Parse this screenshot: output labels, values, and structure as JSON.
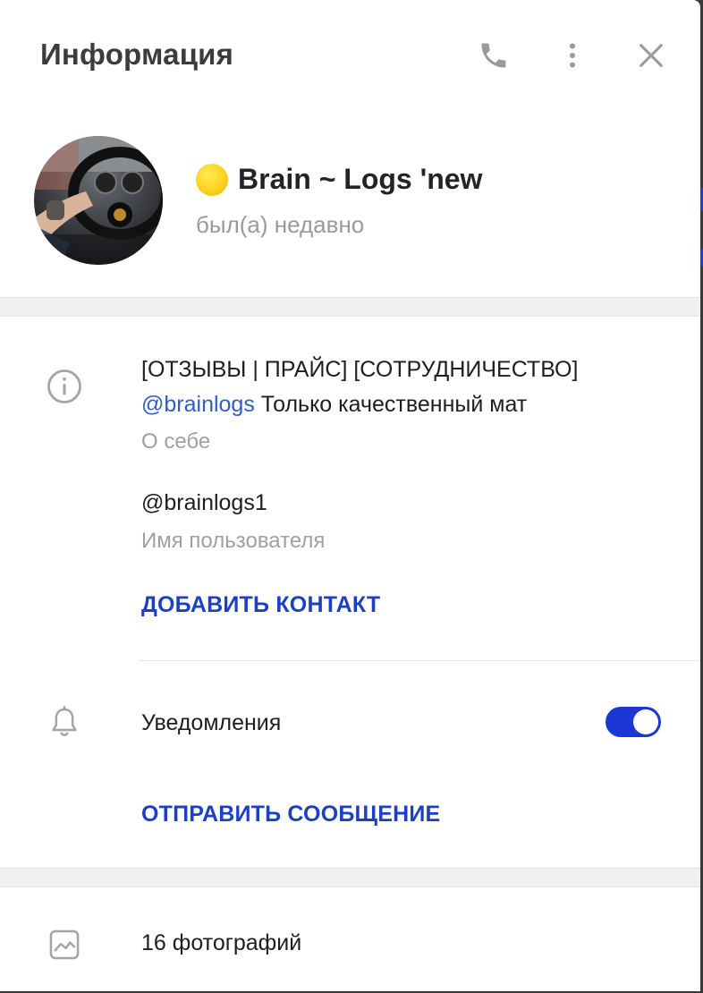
{
  "header": {
    "title": "Информация",
    "icons": [
      "phone-icon",
      "more-vertical-icon",
      "close-icon"
    ]
  },
  "profile": {
    "status_emoji_color": "#ffd21f",
    "name": "Brain ~ Logs 'new",
    "last_seen": "был(а) недавно"
  },
  "info": {
    "bio_line1": "[ОТЗЫВЫ | ПРАЙС] [СОТРУДНИЧЕСТВО]",
    "bio_link": "@brainlogs",
    "bio_rest": " Только качественный мат",
    "bio_label": "О себе",
    "username": "@brainlogs1",
    "username_label": "Имя пользователя",
    "add_contact": "ДОБАВИТЬ КОНТАКТ",
    "notifications_label": "Уведомления",
    "notifications_on": true,
    "send_message": "ОТПРАВИТЬ СООБЩЕНИЕ"
  },
  "media": {
    "photos_label": "16 фотографий"
  },
  "colors": {
    "accent": "#1c3fc4",
    "toggle": "#1b38d6",
    "link": "#2f5ec7"
  }
}
